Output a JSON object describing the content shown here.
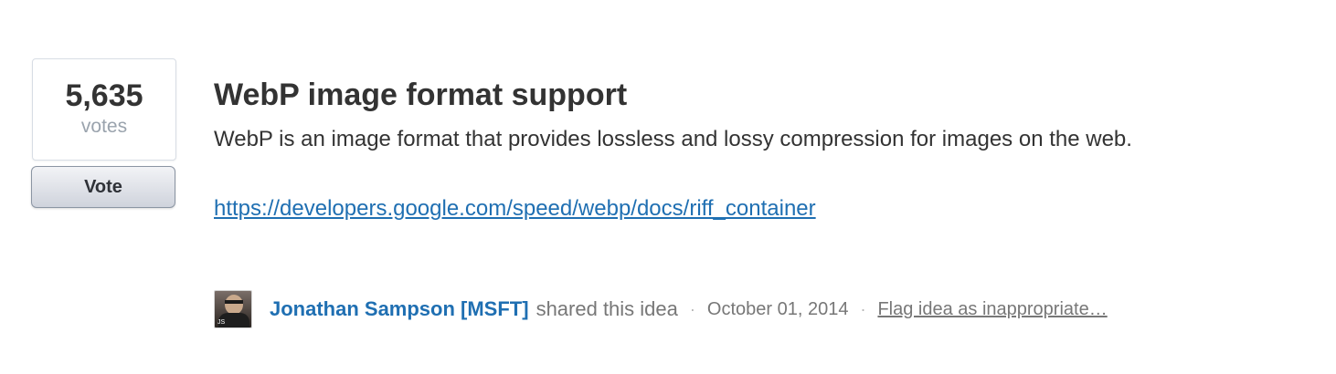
{
  "vote_panel": {
    "count": "5,635",
    "unit": "votes",
    "button_label": "Vote"
  },
  "idea": {
    "title": "WebP image format support",
    "description": "WebP is an image format that provides lossless and lossy compression for images on the web.",
    "link_text": "https://developers.google.com/speed/webp/docs/riff_container"
  },
  "meta": {
    "avatar_initials": "JS",
    "author": "Jonathan Sampson [MSFT]",
    "action": "shared this idea",
    "separator": "·",
    "date": "October 01, 2014",
    "flag_label": "Flag idea as inappropriate…"
  },
  "colors": {
    "link": "#1f6fb2",
    "text": "#333333",
    "muted": "#777777"
  }
}
